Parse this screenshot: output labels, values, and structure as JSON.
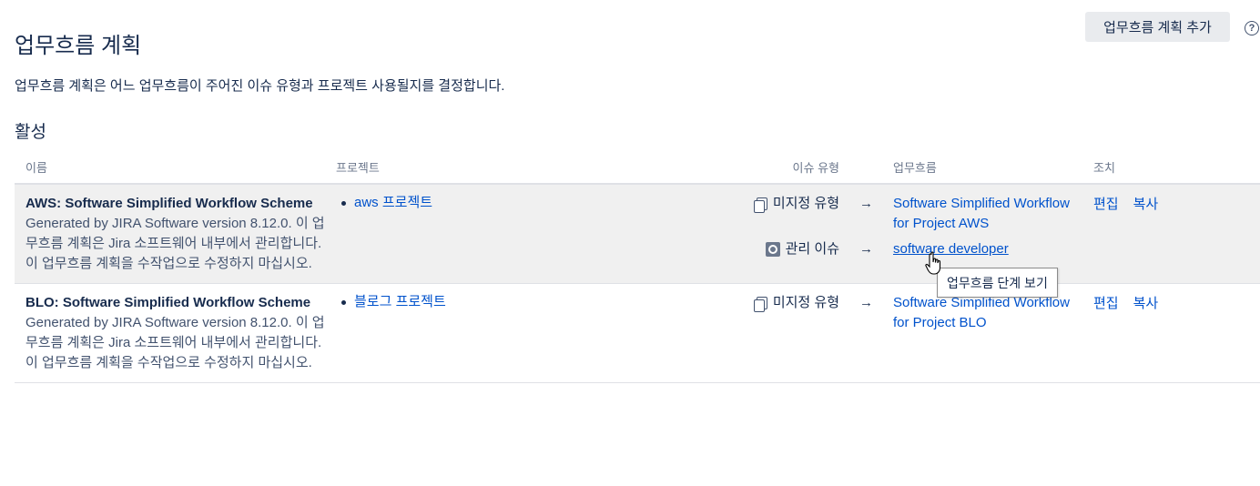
{
  "header": {
    "title": "업무흐름 계획",
    "add_button_label": "업무흐름 계획 추가",
    "help_glyph": "?"
  },
  "description": "업무흐름 계획은 어느 업무흐름이 주어진 이슈 유형과 프로젝트 사용될지를 결정합니다.",
  "section_heading": "활성",
  "table": {
    "columns": {
      "name": "이름",
      "projects": "프로젝트",
      "issue_type": "이슈 유형",
      "workflow": "업무흐름",
      "actions": "조치"
    },
    "rows": [
      {
        "name": "AWS: Software Simplified Workflow Scheme",
        "description": "Generated by JIRA Software version 8.12.0. 이 업무흐름 계획은 Jira 소프트웨어 내부에서 관리합니다. 이 업무흐름 계획을 수작업으로 수정하지 마십시오.",
        "projects": [
          "aws 프로젝트"
        ],
        "mappings": [
          {
            "issue_type": "미지정 유형",
            "issue_icon": "unassigned-type-icon",
            "arrow": "→",
            "workflow": "Software Simplified Workflow for Project AWS"
          },
          {
            "issue_type": "관리 이슈",
            "issue_icon": "admin-issue-icon",
            "arrow": "→",
            "workflow": "software developer"
          }
        ],
        "actions": {
          "edit": "편집",
          "copy": "복사"
        }
      },
      {
        "name": "BLO: Software Simplified Workflow Scheme",
        "description": "Generated by JIRA Software version 8.12.0. 이 업무흐름 계획은 Jira 소프트웨어 내부에서 관리합니다. 이 업무흐름 계획을 수작업으로 수정하지 마십시오.",
        "projects": [
          "블로그 프로젝트"
        ],
        "mappings": [
          {
            "issue_type": "미지정 유형",
            "issue_icon": "unassigned-type-icon",
            "arrow": "→",
            "workflow": "Software Simplified Workflow for Project BLO"
          }
        ],
        "actions": {
          "edit": "편집",
          "copy": "복사"
        }
      }
    ]
  },
  "tooltip": "업무흐름 단계 보기",
  "colors": {
    "link": "#0052cc",
    "text": "#172b4d",
    "row_hover": "#f0f0f0",
    "button_bg": "#e9ebee"
  }
}
